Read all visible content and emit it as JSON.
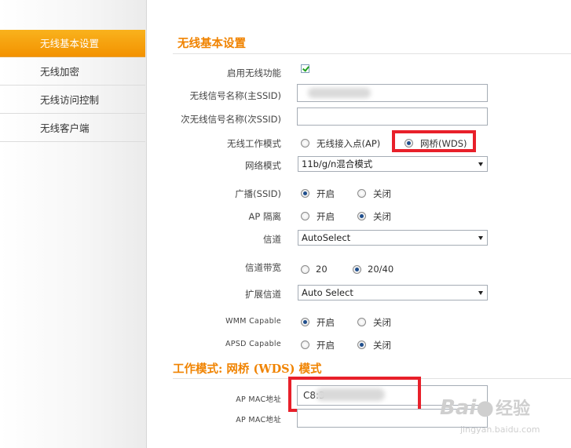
{
  "sidebar": {
    "items": [
      {
        "label": "无线基本设置",
        "active": true
      },
      {
        "label": "无线加密",
        "active": false
      },
      {
        "label": "无线访问控制",
        "active": false
      },
      {
        "label": "无线客户端",
        "active": false
      }
    ]
  },
  "section1": {
    "title": "无线基本设置"
  },
  "form": {
    "enable_wireless": {
      "label": "启用无线功能",
      "checked": true
    },
    "primary_ssid": {
      "label": "无线信号名称(主SSID)",
      "value": ""
    },
    "secondary_ssid": {
      "label": "次无线信号名称(次SSID)",
      "value": ""
    },
    "work_mode": {
      "label": "无线工作模式",
      "opt_ap": "无线接入点(AP)",
      "opt_wds": "网桥(WDS)",
      "selected": "wds"
    },
    "network_mode": {
      "label": "网络模式",
      "value": "11b/g/n混合模式"
    },
    "broadcast": {
      "label": "广播(SSID)",
      "on": "开启",
      "off": "关闭",
      "selected": "on"
    },
    "ap_isolation": {
      "label": "AP 隔离",
      "on": "开启",
      "off": "关闭",
      "selected": "off"
    },
    "channel": {
      "label": "信道",
      "value": "AutoSelect"
    },
    "bandwidth": {
      "label": "信道带宽",
      "opt_20": "20",
      "opt_2040": "20/40",
      "selected": "20/40"
    },
    "ext_channel": {
      "label": "扩展信道",
      "value": "Auto Select"
    },
    "wmm": {
      "label": "WMM Capable",
      "on": "开启",
      "off": "关闭",
      "selected": "on"
    },
    "apsd": {
      "label": "APSD Capable",
      "on": "开启",
      "off": "关闭",
      "selected": "off"
    }
  },
  "section2": {
    "title": "工作模式: 网桥 (WDS) 模式"
  },
  "wds": {
    "mac1": {
      "label": "AP MAC地址",
      "value": "C8:3"
    },
    "mac2": {
      "label": "AP MAC地址",
      "value": ""
    }
  },
  "watermark": {
    "brand": "Bai",
    "brand2": "经验",
    "url": "jingyan.baidu.com"
  },
  "colors": {
    "accent": "#f39200",
    "highlight": "#e8202a",
    "radio_dot": "#1f4e8c"
  }
}
